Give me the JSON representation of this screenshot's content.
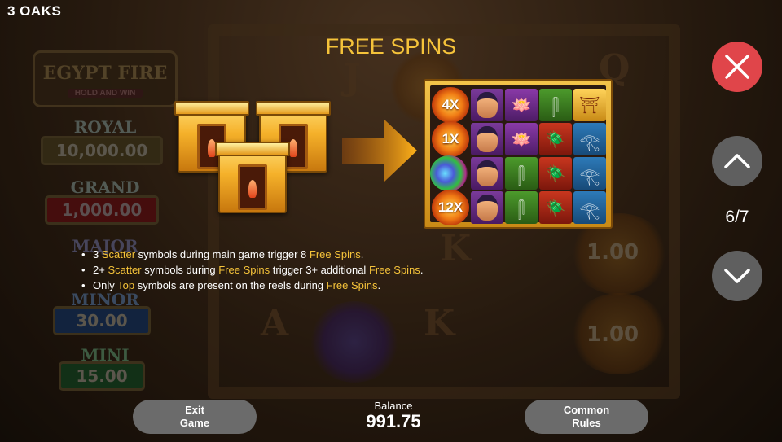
{
  "brand": "3 OAKS",
  "title": "FREE SPINS",
  "background": {
    "logo_title": "EGYPT FIRE",
    "logo_subtitle": "HOLD AND WIN",
    "jackpots": [
      {
        "label": "ROYAL",
        "value": "10,000.00",
        "color": "#6b5a2a"
      },
      {
        "label": "GRAND",
        "value": "1,000.00",
        "color": "#7a1616"
      },
      {
        "label": "MAJOR",
        "value": "",
        "color": "#3a2a6a"
      },
      {
        "label": "MINOR",
        "value": "30.00",
        "color": "#1a3a6a"
      },
      {
        "label": "MINI",
        "value": "15.00",
        "color": "#1e5a2a"
      }
    ],
    "orb_values": [
      "1.00",
      "1.00"
    ]
  },
  "multipliers": [
    "4X",
    "1X",
    "12X"
  ],
  "rules": [
    {
      "parts": [
        {
          "t": "3 ",
          "hl": false
        },
        {
          "t": "Scatter",
          "hl": true
        },
        {
          "t": " symbols during main game trigger 8 ",
          "hl": false
        },
        {
          "t": "Free Spins",
          "hl": true
        },
        {
          "t": ".",
          "hl": false
        }
      ]
    },
    {
      "parts": [
        {
          "t": "2+ ",
          "hl": false
        },
        {
          "t": "Scatter",
          "hl": true
        },
        {
          "t": " symbols during ",
          "hl": false
        },
        {
          "t": "Free Spins",
          "hl": true
        },
        {
          "t": " trigger 3+ additional ",
          "hl": false
        },
        {
          "t": "Free Spins",
          "hl": true
        },
        {
          "t": ".",
          "hl": false
        }
      ]
    },
    {
      "parts": [
        {
          "t": "Only ",
          "hl": false
        },
        {
          "t": "Top",
          "hl": true
        },
        {
          "t": " symbols are present on the reels during ",
          "hl": false
        },
        {
          "t": "Free Spins",
          "hl": true
        },
        {
          "t": ".",
          "hl": false
        }
      ]
    }
  ],
  "pagination": {
    "current": 6,
    "total": 7,
    "label": "6/7"
  },
  "controls": {
    "close_icon": "close-icon",
    "up_icon": "chevron-up-icon",
    "down_icon": "chevron-down-icon"
  },
  "footer": {
    "exit_line1": "Exit",
    "exit_line2": "Game",
    "balance_label": "Balance",
    "balance_value": "991.75",
    "rules_line1": "Common",
    "rules_line2": "Rules"
  },
  "colors": {
    "highlight": "#f5c33a",
    "close_button": "#e0454a",
    "nav_button": "#5f5f5f",
    "footer_button": "#6b6b6b"
  }
}
